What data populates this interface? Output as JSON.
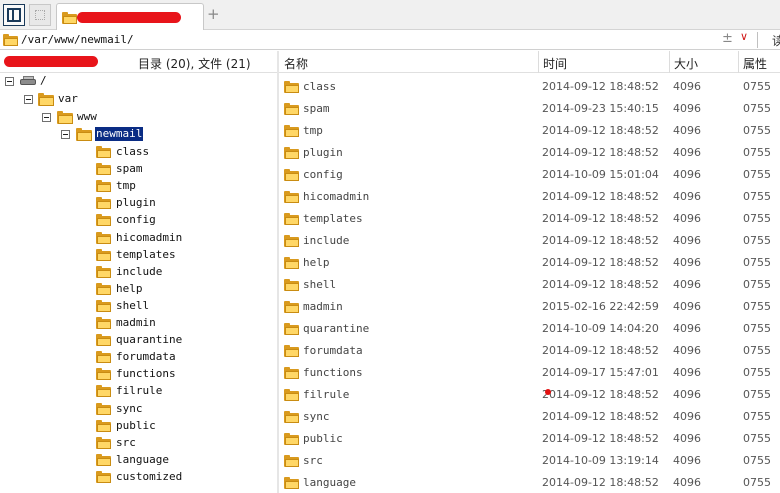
{
  "address": {
    "path": "/var/www/newmail/",
    "plus_minus": "±",
    "dropdown": "∨",
    "go_label": "读"
  },
  "tabs": {
    "add_label": "+"
  },
  "left_header": {
    "count_label": "目录 (20), 文件 (21)"
  },
  "columns": {
    "name": "名称",
    "time": "时间",
    "size": "大小",
    "attr": "属性"
  },
  "tree": {
    "root": "/",
    "var": "var",
    "www": "www",
    "current": "newmail",
    "children": [
      "class",
      "spam",
      "tmp",
      "plugin",
      "config",
      "hicomadmin",
      "templates",
      "include",
      "help",
      "shell",
      "madmin",
      "quarantine",
      "forumdata",
      "functions",
      "filrule",
      "sync",
      "public",
      "src",
      "language",
      "customized"
    ]
  },
  "files": [
    {
      "name": "class",
      "time": "2014-09-12 18:48:52",
      "size": "4096",
      "attr": "0755"
    },
    {
      "name": "spam",
      "time": "2014-09-23 15:40:15",
      "size": "4096",
      "attr": "0755"
    },
    {
      "name": "tmp",
      "time": "2014-09-12 18:48:52",
      "size": "4096",
      "attr": "0755"
    },
    {
      "name": "plugin",
      "time": "2014-09-12 18:48:52",
      "size": "4096",
      "attr": "0755"
    },
    {
      "name": "config",
      "time": "2014-10-09 15:01:04",
      "size": "4096",
      "attr": "0755"
    },
    {
      "name": "hicomadmin",
      "time": "2014-09-12 18:48:52",
      "size": "4096",
      "attr": "0755"
    },
    {
      "name": "templates",
      "time": "2014-09-12 18:48:52",
      "size": "4096",
      "attr": "0755"
    },
    {
      "name": "include",
      "time": "2014-09-12 18:48:52",
      "size": "4096",
      "attr": "0755"
    },
    {
      "name": "help",
      "time": "2014-09-12 18:48:52",
      "size": "4096",
      "attr": "0755"
    },
    {
      "name": "shell",
      "time": "2014-09-12 18:48:52",
      "size": "4096",
      "attr": "0755"
    },
    {
      "name": "madmin",
      "time": "2015-02-16 22:42:59",
      "size": "4096",
      "attr": "0755"
    },
    {
      "name": "quarantine",
      "time": "2014-10-09 14:04:20",
      "size": "4096",
      "attr": "0755"
    },
    {
      "name": "forumdata",
      "time": "2014-09-12 18:48:52",
      "size": "4096",
      "attr": "0755"
    },
    {
      "name": "functions",
      "time": "2014-09-17 15:47:01",
      "size": "4096",
      "attr": "0755"
    },
    {
      "name": "filrule",
      "time": "2014-09-12 18:48:52",
      "size": "4096",
      "attr": "0755"
    },
    {
      "name": "sync",
      "time": "2014-09-12 18:48:52",
      "size": "4096",
      "attr": "0755"
    },
    {
      "name": "public",
      "time": "2014-09-12 18:48:52",
      "size": "4096",
      "attr": "0755"
    },
    {
      "name": "src",
      "time": "2014-10-09 13:19:14",
      "size": "4096",
      "attr": "0755"
    },
    {
      "name": "language",
      "time": "2014-09-12 18:48:52",
      "size": "4096",
      "attr": "0755"
    }
  ]
}
